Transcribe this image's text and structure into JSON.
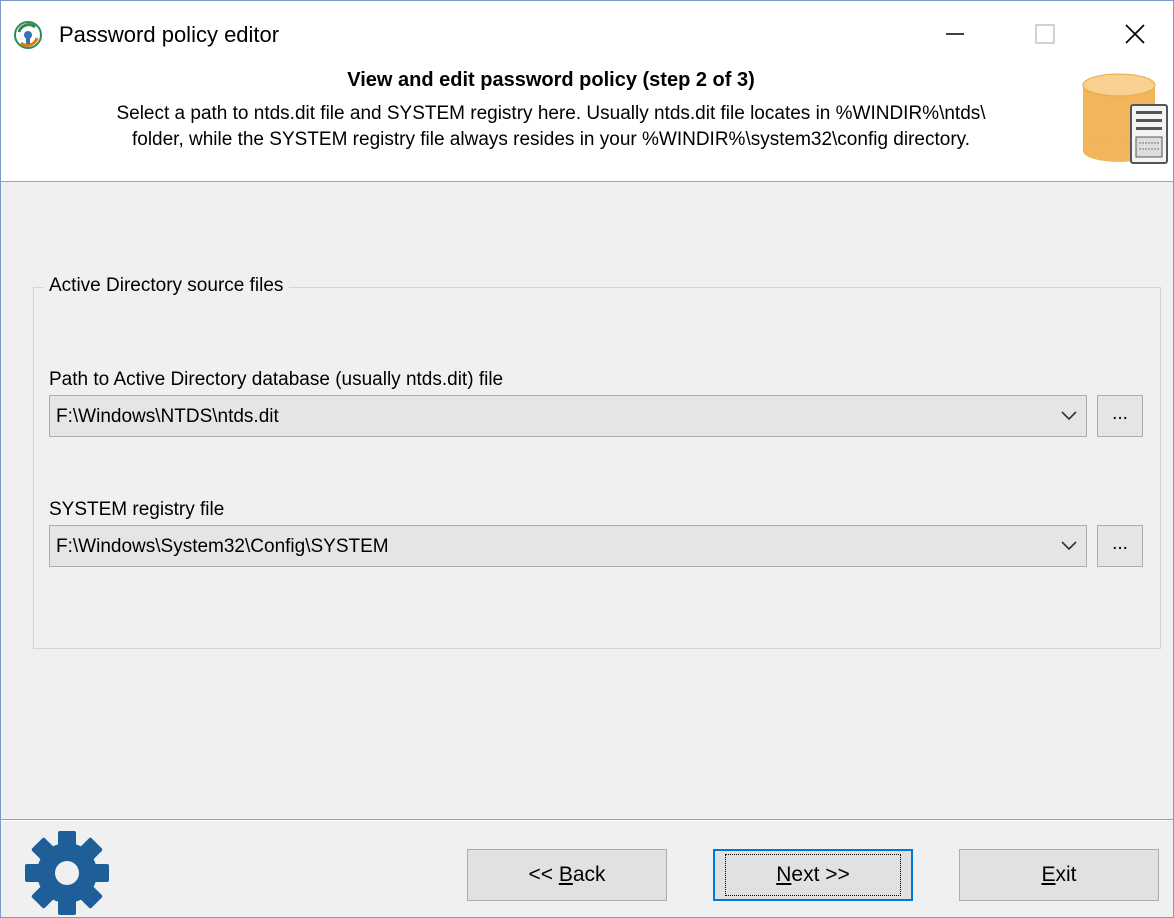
{
  "window": {
    "title": "Password policy editor"
  },
  "header": {
    "title": "View and edit password policy (step 2 of 3)",
    "description_line1": "Select a path to ntds.dit file and SYSTEM registry here. Usually ntds.dit file locates in %WINDIR%\\ntds\\",
    "description_line2": "folder, while the SYSTEM registry file always resides in your %WINDIR%\\system32\\config directory."
  },
  "group": {
    "legend": "Active Directory source files",
    "ntds": {
      "label": "Path to Active Directory database (usually ntds.dit) file",
      "value": "F:\\Windows\\NTDS\\ntds.dit",
      "browse_label": "..."
    },
    "system": {
      "label": "SYSTEM registry file",
      "value": "F:\\Windows\\System32\\Config\\SYSTEM",
      "browse_label": "..."
    }
  },
  "buttons": {
    "back": {
      "pre": "<< ",
      "accel": "B",
      "post": "ack"
    },
    "next": {
      "pre": "",
      "accel": "N",
      "post": "ext >>"
    },
    "exit": {
      "pre": "",
      "accel": "E",
      "post": "xit"
    }
  },
  "icons": {
    "app": "password-policy-app-icon",
    "header": "database-server-icon",
    "footer": "gear-icon"
  },
  "colors": {
    "accent": "#0078d7",
    "gear": "#1e5f99",
    "database": "#f2b55a"
  }
}
